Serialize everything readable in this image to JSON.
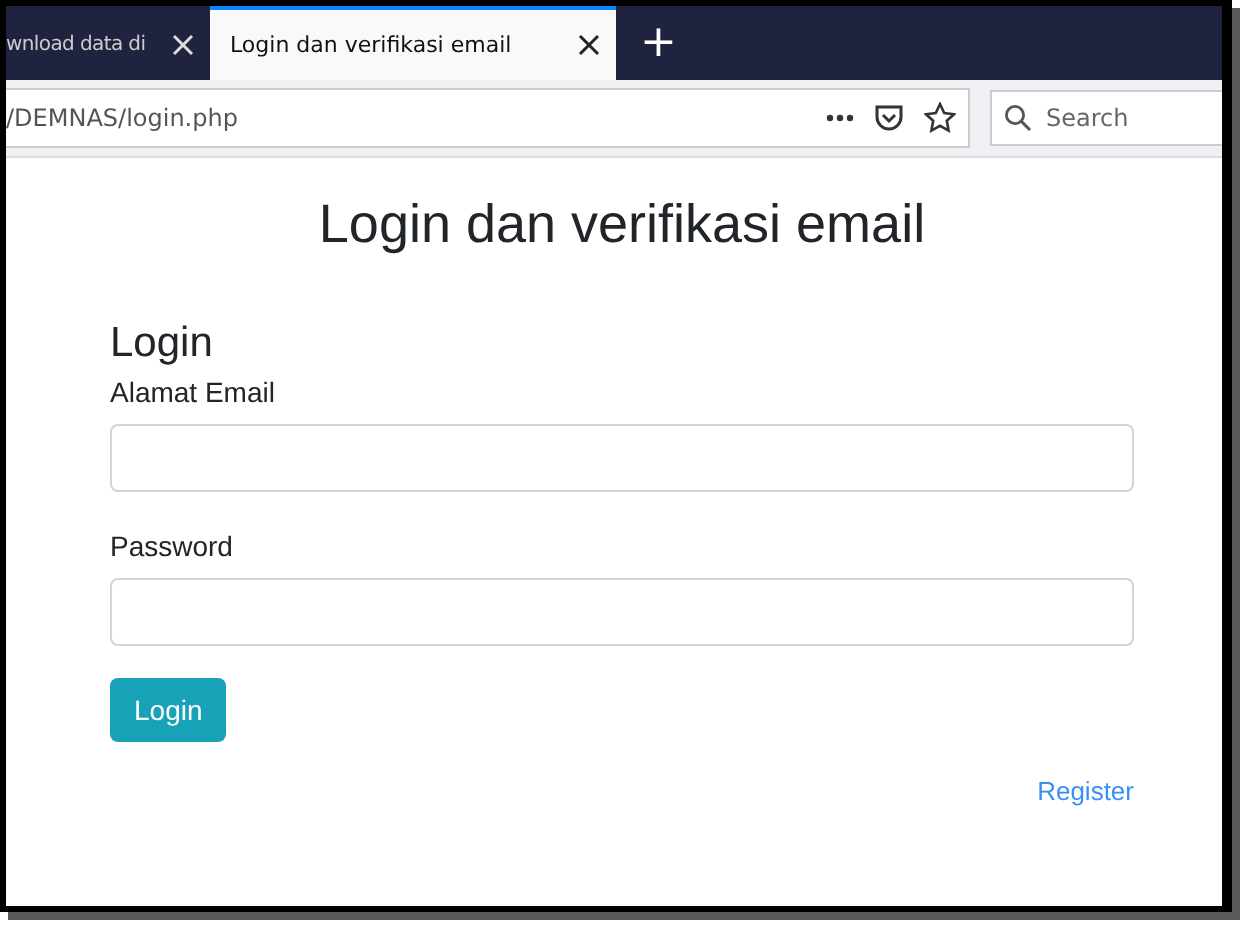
{
  "browser": {
    "tabs": [
      {
        "title": "wnload data di",
        "selected": false
      },
      {
        "title": "Login dan verifikasi email",
        "selected": true
      }
    ],
    "new_tab": "+",
    "url": "/DEMNAS/login.php",
    "search": {
      "placeholder": "Search"
    }
  },
  "page": {
    "title": "Login dan verifikasi email",
    "heading": "Login",
    "fields": [
      {
        "label": "Alamat Email"
      },
      {
        "label": "Password"
      }
    ],
    "submit": "Login",
    "register_link": "Register"
  }
}
